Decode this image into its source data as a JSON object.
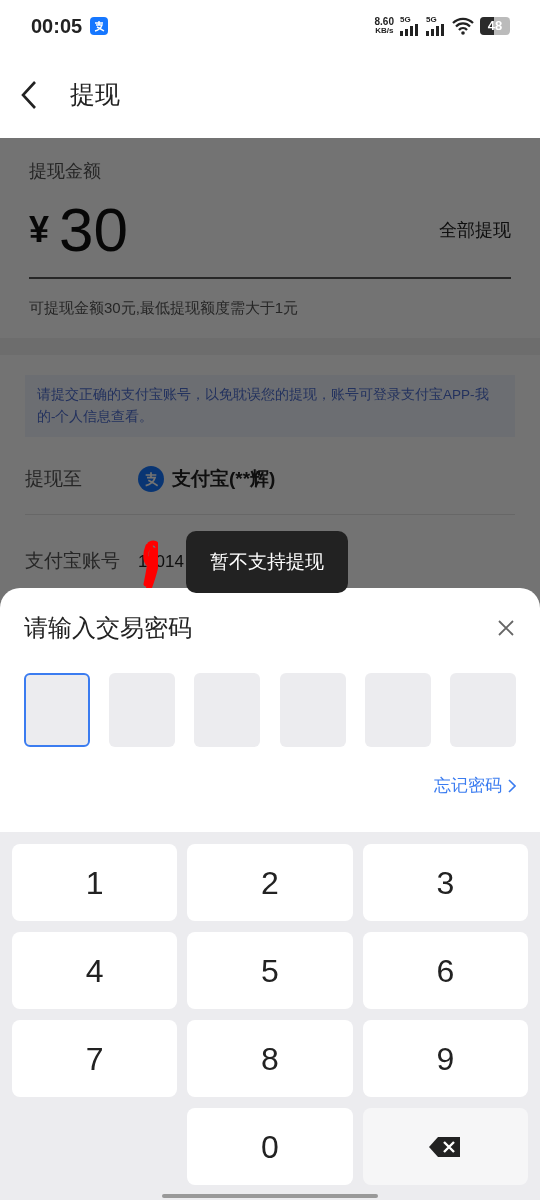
{
  "status_bar": {
    "time": "00:05",
    "speed": "8.60",
    "speed_unit": "KB/s",
    "signals": [
      "5G",
      "5G"
    ],
    "battery": "48"
  },
  "header": {
    "title": "提现"
  },
  "amount_card": {
    "label": "提现金额",
    "currency": "¥",
    "amount": "30",
    "withdraw_all": "全部提现",
    "hint": "可提现金额30元,最低提现额度需大于1元"
  },
  "account_card": {
    "notice": "请提交正确的支付宝账号，以免耽误您的提现，账号可登录支付宝APP-我的-个人信息查看。",
    "rows": [
      {
        "label": "提现至",
        "value": "支付宝(**辉)",
        "kind": "method"
      },
      {
        "label": "支付宝账号",
        "value_parts": [
          "1",
          "014"
        ],
        "kind": "account"
      }
    ]
  },
  "toast": "暂不支持提现",
  "password_sheet": {
    "title": "请输入交易密码",
    "digits": [
      {
        "selected": true
      },
      {
        "selected": false
      },
      {
        "selected": false
      },
      {
        "selected": false
      },
      {
        "selected": false
      },
      {
        "selected": false
      }
    ],
    "forgot": "忘记密码"
  },
  "keypad": {
    "keys": [
      {
        "kind": "digit",
        "label": "1"
      },
      {
        "kind": "digit",
        "label": "2"
      },
      {
        "kind": "digit",
        "label": "3"
      },
      {
        "kind": "digit",
        "label": "4"
      },
      {
        "kind": "digit",
        "label": "5"
      },
      {
        "kind": "digit",
        "label": "6"
      },
      {
        "kind": "digit",
        "label": "7"
      },
      {
        "kind": "digit",
        "label": "8"
      },
      {
        "kind": "digit",
        "label": "9"
      },
      {
        "kind": "blank"
      },
      {
        "kind": "digit",
        "label": "0"
      },
      {
        "kind": "backspace"
      }
    ]
  }
}
